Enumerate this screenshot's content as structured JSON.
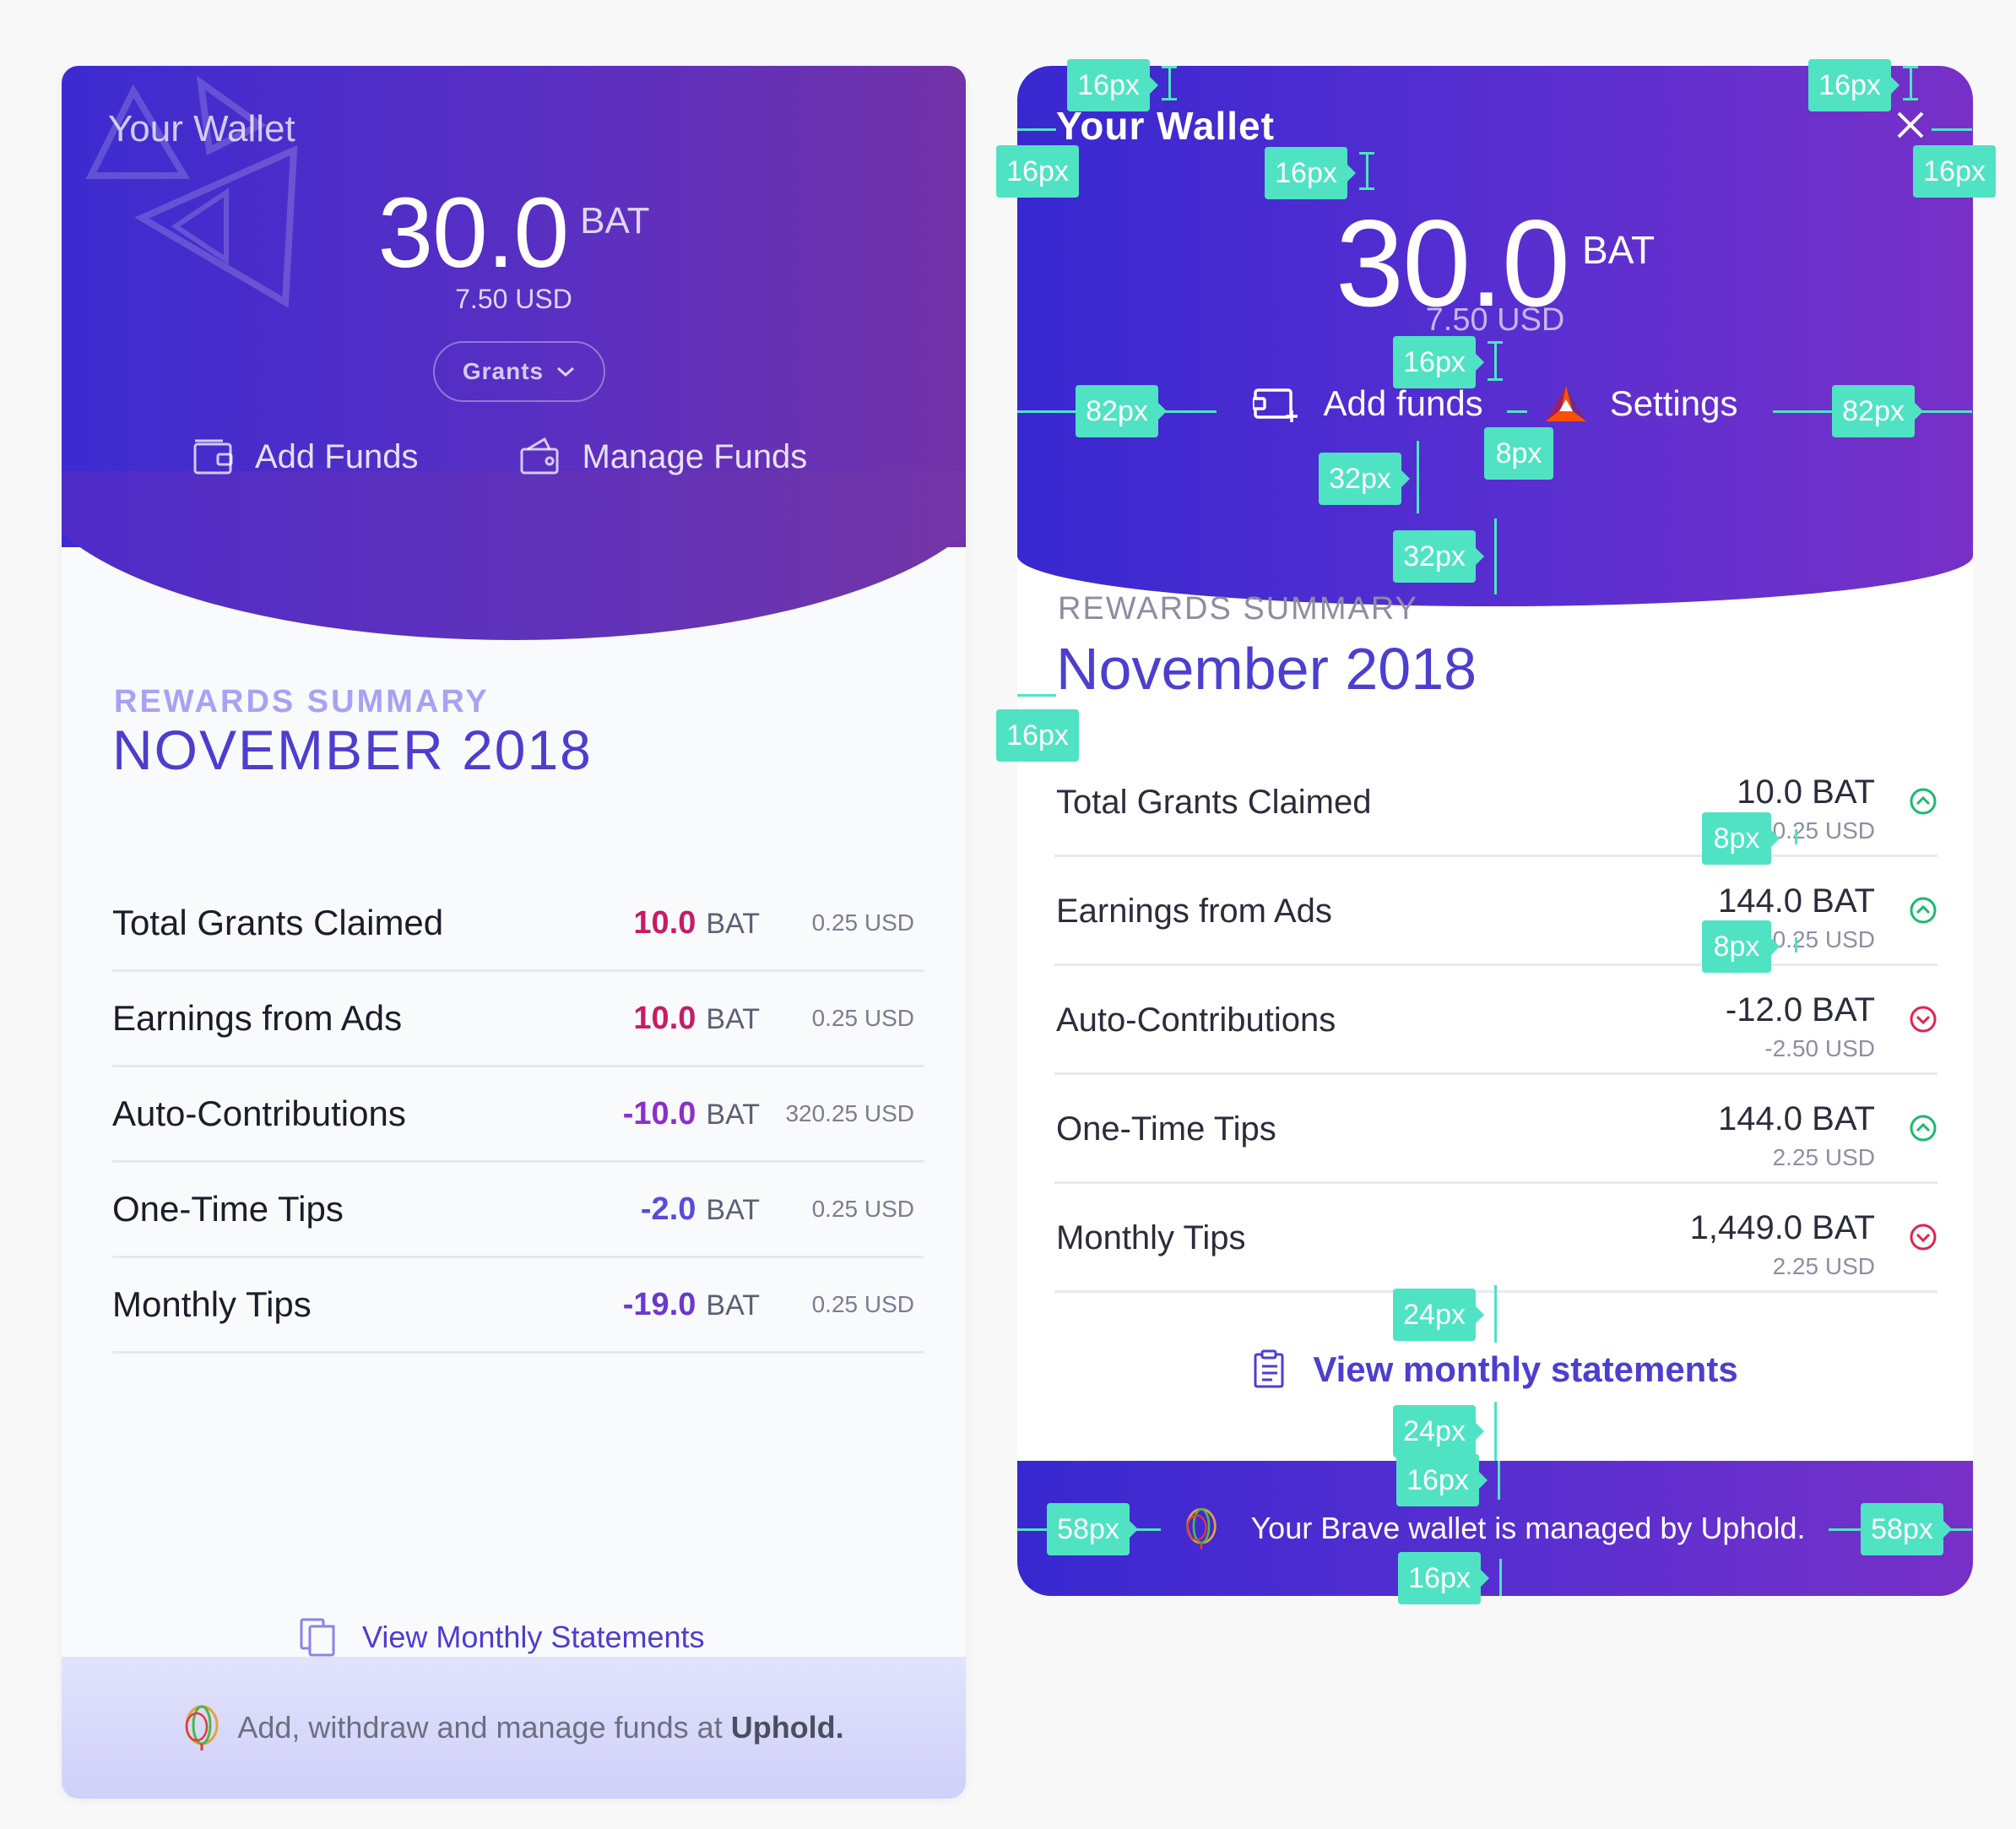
{
  "left": {
    "wallet_title": "Your Wallet",
    "balance": "30.0",
    "balance_unit": "BAT",
    "balance_usd": "7.50 USD",
    "grants_label": "Grants",
    "add_funds": "Add Funds",
    "manage_funds": "Manage Funds",
    "summary_label": "REWARDS SUMMARY",
    "summary_date": "NOVEMBER 2018",
    "rows": [
      {
        "label": "Total Grants Claimed",
        "amount": "10.0",
        "unit": "BAT",
        "usd": "0.25 USD",
        "color": "#c71c66"
      },
      {
        "label": "Earnings from Ads",
        "amount": "10.0",
        "unit": "BAT",
        "usd": "0.25 USD",
        "color": "#c71c66"
      },
      {
        "label": "Auto-Contributions",
        "amount": "-10.0",
        "unit": "BAT",
        "usd": "320.25 USD",
        "color": "#8c30c6"
      },
      {
        "label": "One-Time Tips",
        "amount": "-2.0",
        "unit": "BAT",
        "usd": "0.25 USD",
        "color": "#5a4bdc"
      },
      {
        "label": "Monthly Tips",
        "amount": "-19.0",
        "unit": "BAT",
        "usd": "0.25 USD",
        "color": "#6a39cf"
      }
    ],
    "statements": "View Monthly Statements",
    "footer_text": "Add, withdraw and manage funds at ",
    "footer_bold": "Uphold."
  },
  "right": {
    "wallet_title": "Your Wallet",
    "balance": "30.0",
    "balance_unit": "BAT",
    "balance_usd": "7.50 USD",
    "add_funds": "Add funds",
    "settings": "Settings",
    "summary_label": "REWARDS SUMMARY",
    "summary_date": "November 2018",
    "rows": [
      {
        "label": "Total Grants Claimed",
        "bat": "10.0 BAT",
        "usd": "0.25 USD",
        "trend": "up"
      },
      {
        "label": "Earnings from Ads",
        "bat": "144.0 BAT",
        "usd": "0.25 USD",
        "trend": "up"
      },
      {
        "label": "Auto-Contributions",
        "bat": "-12.0 BAT",
        "usd": "-2.50 USD",
        "trend": "down"
      },
      {
        "label": "One-Time Tips",
        "bat": "144.0 BAT",
        "usd": "2.25 USD",
        "trend": "up"
      },
      {
        "label": "Monthly Tips",
        "bat": "1,449.0 BAT",
        "usd": "2.25 USD",
        "trend": "down"
      }
    ],
    "statements": "View monthly statements",
    "footer_text": "Your Brave wallet is managed by Uphold."
  },
  "annotations": {
    "a1": "16px",
    "a2": "16px",
    "a3": "16px",
    "a4": "16px",
    "a5": "16px",
    "a6": "16px",
    "a7": "82px",
    "a8": "82px",
    "a9": "8px",
    "a10": "32px",
    "a11": "32px",
    "a12": "16px",
    "a13": "8px",
    "a14": "8px",
    "a15": "24px",
    "a16": "24px",
    "a17": "16px",
    "a18": "58px",
    "a19": "58px",
    "a20": "16px"
  },
  "colors": {
    "accent": "#4c3fcf",
    "annotation": "#4fe3c3",
    "up": "#1bba6e",
    "down": "#e3224e"
  }
}
